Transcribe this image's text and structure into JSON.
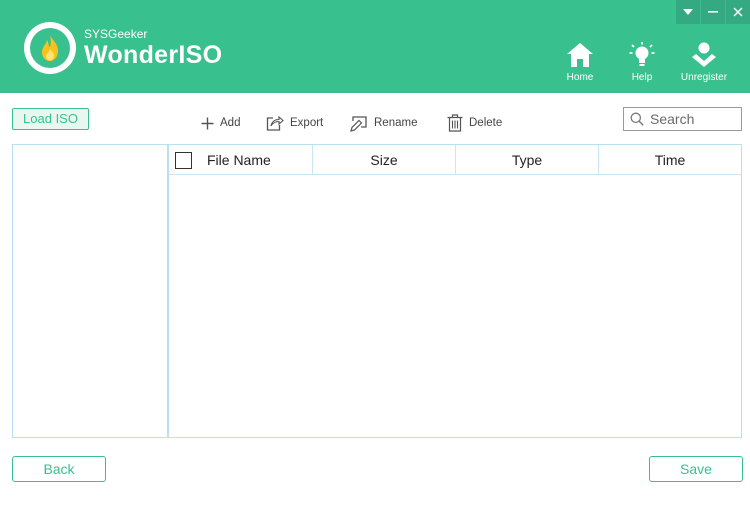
{
  "app": {
    "brand_small": "SYSGeeker",
    "brand_name": "WonderISO",
    "accent_color": "#39c08f"
  },
  "window_controls": [
    {
      "icon": "dropdown-icon"
    },
    {
      "icon": "minimize-icon"
    },
    {
      "icon": "close-icon"
    }
  ],
  "nav": {
    "home": {
      "label": "Home",
      "icon": "home-icon"
    },
    "help": {
      "label": "Help",
      "icon": "lightbulb-icon"
    },
    "unregister": {
      "label": "Unregister",
      "icon": "user-icon"
    }
  },
  "toolbar": {
    "load_iso": "Load ISO",
    "add": "Add",
    "export": "Export",
    "rename": "Rename",
    "delete": "Delete"
  },
  "search": {
    "placeholder": "Search",
    "value": ""
  },
  "file_table": {
    "columns": [
      "File Name",
      "Size",
      "Type",
      "Time"
    ],
    "rows": []
  },
  "footer": {
    "back": "Back",
    "save": "Save"
  }
}
